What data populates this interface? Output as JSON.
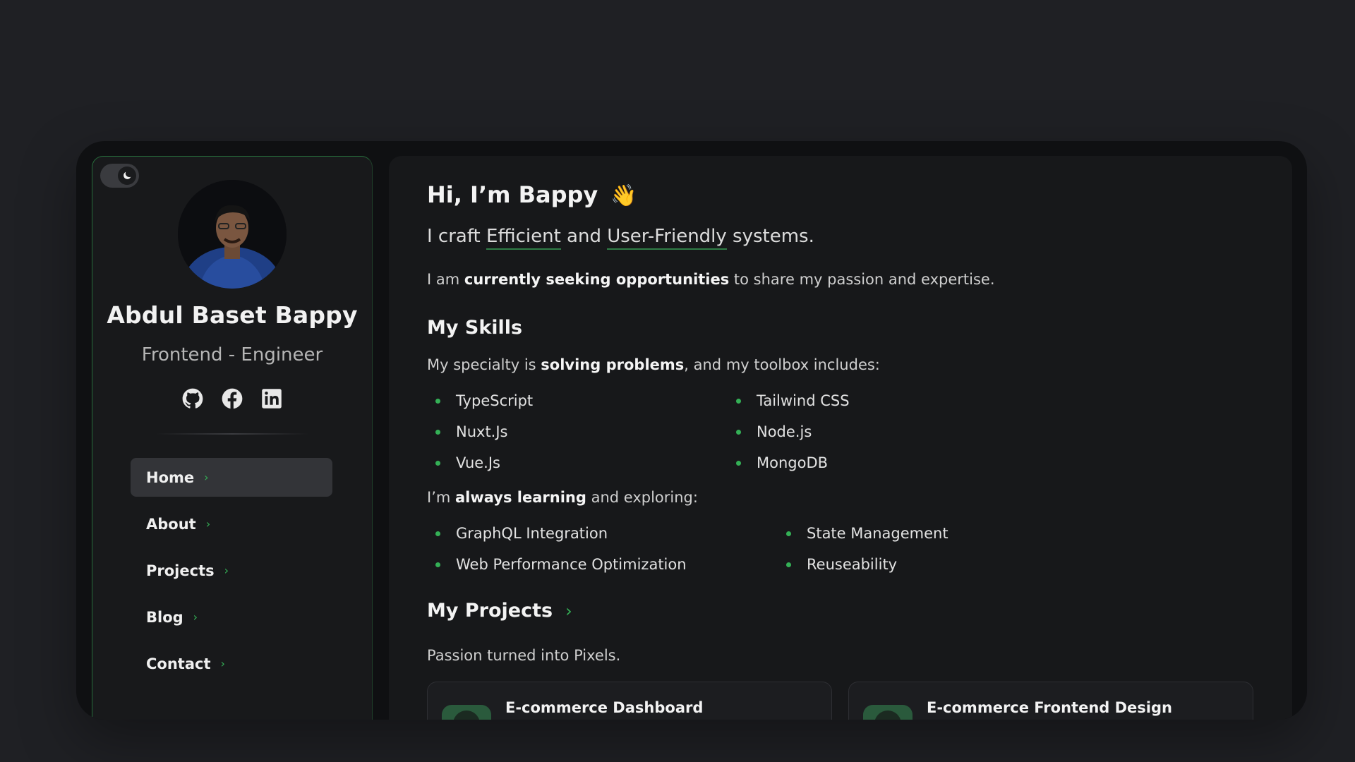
{
  "theme": {
    "accent": "#34b056",
    "background": "#1f2024",
    "panel": "#17181a"
  },
  "sidebar": {
    "theme_toggle_icon": "moon-icon",
    "name": "Abdul Baset Bappy",
    "role": "Frontend - Engineer",
    "socials": [
      {
        "icon": "github-icon"
      },
      {
        "icon": "facebook-icon"
      },
      {
        "icon": "linkedin-icon"
      }
    ],
    "nav": [
      {
        "label": "Home",
        "active": true
      },
      {
        "label": "About"
      },
      {
        "label": "Projects"
      },
      {
        "label": "Blog"
      },
      {
        "label": "Contact"
      }
    ]
  },
  "main": {
    "greeting": "Hi, I’m Bappy",
    "greeting_emoji": "👋",
    "craft": {
      "prefix": "I craft ",
      "word1": "Efficient",
      "mid": " and ",
      "word2": "User-Friendly",
      "suffix": " systems."
    },
    "seeking": {
      "prefix": "I am ",
      "bold": "currently seeking opportunities",
      "suffix": " to share my passion and expertise."
    },
    "skills_heading": "My Skills",
    "specialty": {
      "prefix": "My specialty is ",
      "bold": "solving problems",
      "suffix": ", and my toolbox includes:"
    },
    "skills_col1": [
      "TypeScript",
      "Nuxt.Js",
      "Vue.Js"
    ],
    "skills_col2": [
      "Tailwind CSS",
      "Node.js",
      "MongoDB"
    ],
    "learning": {
      "prefix": "I’m ",
      "bold": "always learning",
      "suffix": " and exploring:"
    },
    "learning_col1": [
      "GraphQL Integration",
      "Web Performance Optimization"
    ],
    "learning_col2": [
      "State Management",
      "Reuseability"
    ],
    "projects_heading": "My Projects",
    "projects_tagline": "Passion turned into Pixels.",
    "projects": [
      {
        "title": "E-commerce Dashboard"
      },
      {
        "title": "E-commerce Frontend Design"
      }
    ]
  }
}
